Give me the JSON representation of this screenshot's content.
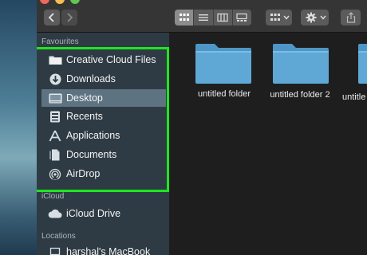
{
  "sidebar": {
    "favourites_header": "Favourites",
    "favourites": [
      {
        "label": "Creative Cloud Files",
        "icon": "folder-icon"
      },
      {
        "label": "Downloads",
        "icon": "downloads-icon"
      },
      {
        "label": "Desktop",
        "icon": "desktop-icon",
        "selected": true
      },
      {
        "label": "Recents",
        "icon": "recents-icon"
      },
      {
        "label": "Applications",
        "icon": "applications-icon"
      },
      {
        "label": "Documents",
        "icon": "documents-icon"
      },
      {
        "label": "AirDrop",
        "icon": "airdrop-icon"
      }
    ],
    "icloud_header": "iCloud",
    "icloud": [
      {
        "label": "iCloud Drive",
        "icon": "cloud-icon"
      }
    ],
    "locations_header": "Locations",
    "locations": [
      {
        "label": "harshal's MacBook",
        "icon": "laptop-icon"
      }
    ]
  },
  "content": {
    "folders": [
      {
        "label": "untitled folder"
      },
      {
        "label": "untitled folder 2"
      },
      {
        "label": "untitle"
      }
    ]
  },
  "colors": {
    "highlight_border": "#1ee61e",
    "folder_blue": "#5fa8d6",
    "sidebar_bg": "#2f3b44",
    "selected_item_bg": "#5e7382"
  }
}
